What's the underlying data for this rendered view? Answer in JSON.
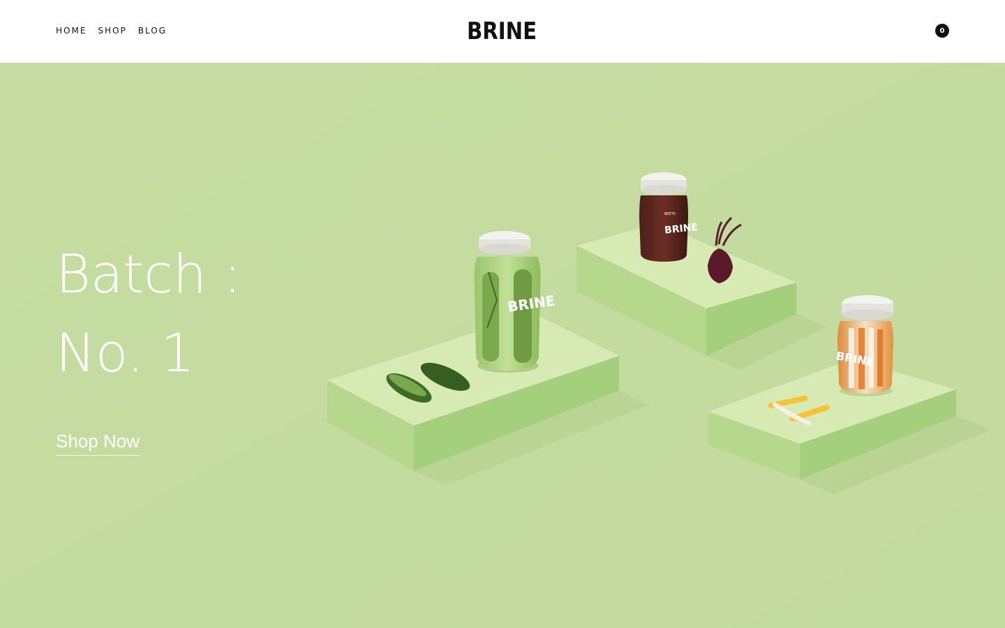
{
  "header": {
    "nav": [
      "HOME",
      "SHOP",
      "BLOG"
    ],
    "logo": "BRINE",
    "cart_count": "0"
  },
  "hero": {
    "title_line1": "Batch :",
    "title_line2": "No. 1",
    "cta": "Shop Now",
    "jar_labels": {
      "pickles": "BRINE",
      "beets": "BRINE",
      "beets_small": "BEETS",
      "carrots": "BRINE"
    }
  },
  "colors": {
    "background": "#c5dca0",
    "pedestal_top": "#d8eab4",
    "pedestal_side": "#a4cf7c"
  }
}
